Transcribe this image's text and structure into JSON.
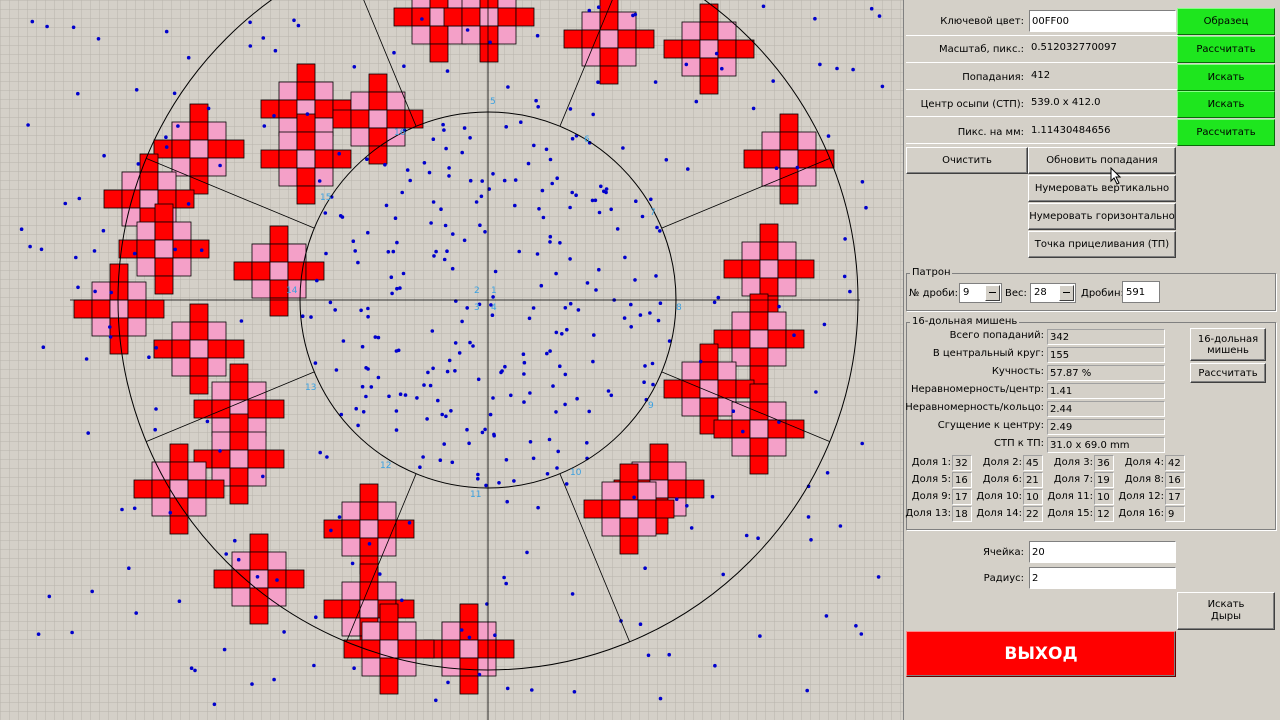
{
  "colors": {
    "hole_fill": "#ff0000",
    "hole_halo": "#f4a0c8",
    "hit_dot": "#0000cc",
    "sector_number": "#3aa0e0",
    "green_button": "#1ee61e",
    "exit_button": "#ff0000"
  },
  "settings": {
    "key_color_label": "Ключевой цвет:",
    "key_color_value": "00FF00",
    "key_color_button": "Образец",
    "scale_label": "Масштаб, пикс.:",
    "scale_value": "0.512032770097",
    "scale_button": "Рассчитать",
    "hits_label": "Попадания:",
    "hits_value": "412",
    "hits_button": "Искать",
    "center_label": "Центр осыпи (СТП):",
    "center_value": "539.0 x 412.0",
    "center_button": "Искать",
    "pxmm_label": "Пикс. на мм:",
    "pxmm_value": "1.11430484656",
    "pxmm_button": "Рассчитать"
  },
  "actions": {
    "clear": "Очистить",
    "update_hits": "Обновить попадания",
    "number_vertical": "Нумеровать вертикально",
    "number_horizontal": "Нумеровать горизонтально",
    "aim_point": "Точка прицеливания (ТП)"
  },
  "cartridge": {
    "group_title": "Патрон",
    "shot_no_label": "№ дроби:",
    "shot_no_value": "9",
    "weight_label": "Вес:",
    "weight_value": "28",
    "pellets_label": "Дробин:",
    "pellets_value": "591"
  },
  "target16": {
    "group_title": "16-дольная мишень",
    "total_hits_label": "Всего попаданий:",
    "total_hits_value": "342",
    "central_label": "В центральный круг:",
    "central_value": "155",
    "density_label": "Кучность:",
    "density_value": "57.87 %",
    "uneven_center_label": "Неравномерность/центр:",
    "uneven_center_value": "1.41",
    "uneven_ring_label": "Неравномерность/кольцо:",
    "uneven_ring_value": "2.44",
    "concentration_label": "Сгущение к центру:",
    "concentration_value": "2.49",
    "stp_label": "СТП к ТП:",
    "stp_value": "31.0 x 69.0 mm",
    "button_16": "16-дольная мишень",
    "button_calc": "Рассчитать",
    "sectors": [
      {
        "label": "Доля 1:",
        "value": "32"
      },
      {
        "label": "Доля 2:",
        "value": "45"
      },
      {
        "label": "Доля 3:",
        "value": "36"
      },
      {
        "label": "Доля 4:",
        "value": "42"
      },
      {
        "label": "Доля 5:",
        "value": "16"
      },
      {
        "label": "Доля 6:",
        "value": "21"
      },
      {
        "label": "Доля 7:",
        "value": "19"
      },
      {
        "label": "Доля 8:",
        "value": "16"
      },
      {
        "label": "Доля 9:",
        "value": "17"
      },
      {
        "label": "Доля 10:",
        "value": "10"
      },
      {
        "label": "Доля 11:",
        "value": "10"
      },
      {
        "label": "Доля 12:",
        "value": "17"
      },
      {
        "label": "Доля 13:",
        "value": "18"
      },
      {
        "label": "Доля 14:",
        "value": "22"
      },
      {
        "label": "Доля 15:",
        "value": "12"
      },
      {
        "label": "Доля 16:",
        "value": "9"
      }
    ]
  },
  "holes": {
    "cell_label": "Ячейка:",
    "cell_value": "20",
    "radius_label": "Радиус:",
    "radius_value": "2",
    "find_button": "Искать Дыры"
  },
  "exit_button": "ВЫХОД",
  "target_numbers": [
    "1",
    "2",
    "3",
    "4",
    "5",
    "6",
    "7",
    "8",
    "9",
    "10",
    "11",
    "12",
    "13",
    "14",
    "15",
    "16"
  ]
}
